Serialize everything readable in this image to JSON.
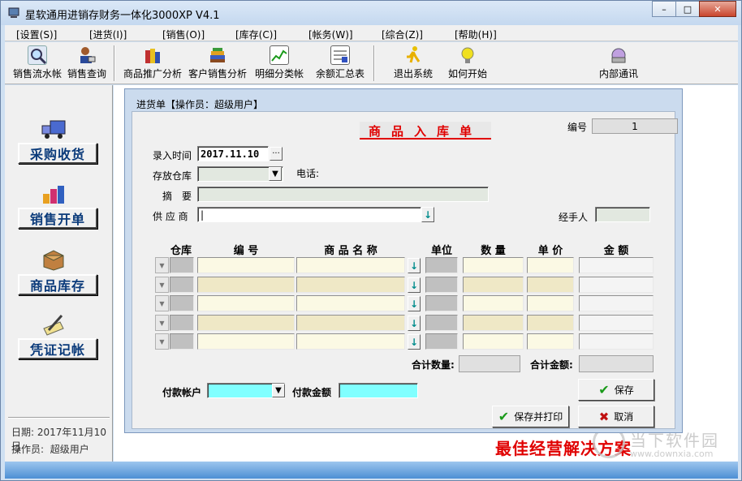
{
  "window": {
    "title": "星软通用进销存财务一体化3000XP V4.1",
    "minimize": "–",
    "maximize": "□",
    "close": "✕"
  },
  "menu": [
    "[设置(S)]",
    "[进货(I)]",
    "[销售(O)]",
    "[库存(C)]",
    "[帐务(W)]",
    "[综合(Z)]",
    "[帮助(H)]"
  ],
  "toolbar": [
    {
      "label": "销售流水帐",
      "icon": "magnifier-chart-icon"
    },
    {
      "label": "销售查询",
      "icon": "person-query-icon"
    },
    {
      "label": "商品推广分析",
      "icon": "gift-box-icon"
    },
    {
      "label": "客户销售分析",
      "icon": "books-icon"
    },
    {
      "label": "明细分类帐",
      "icon": "line-chart-icon"
    },
    {
      "label": "余额汇总表",
      "icon": "ledger-icon"
    },
    {
      "label": "退出系统",
      "icon": "running-man-icon"
    },
    {
      "label": "如何开始",
      "icon": "lightbulb-icon"
    },
    {
      "label": "内部通讯",
      "icon": "network-icon"
    }
  ],
  "sidebar": {
    "buttons": [
      "采购收货",
      "销售开单",
      "商品库存",
      "凭证记帐"
    ],
    "date_label": "日期:",
    "date_value": "2017年11月10日",
    "operator_label": "操作员:",
    "operator_value": "超级用户"
  },
  "dialog": {
    "title": "进货单【操作员：超级用户】",
    "heading": "商品入库单",
    "number_label": "编号",
    "number_value": "1",
    "entry_time_label": "录入时间",
    "entry_time_value": "2017.11.10",
    "date_btn": "···",
    "warehouse_label": "存放仓库",
    "phone_label": "电话:",
    "summary_label": "摘　要",
    "supplier_label": "供 应 商",
    "handler_label": "经手人",
    "columns": [
      "仓库",
      "编 号",
      "商 品 名 称",
      "单位",
      "数 量",
      "单 价",
      "金 额"
    ],
    "total_qty_label": "合计数量:",
    "total_amount_label": "合计金额:",
    "pay_account_label": "付款帐户",
    "pay_amount_label": "付款金额",
    "save_label": "保存",
    "save_print_label": "保存并打印",
    "cancel_label": "取消"
  },
  "slogan": "最佳经营解决方案",
  "watermark": {
    "text": "当下软件园",
    "url": "www.downxia.com"
  }
}
